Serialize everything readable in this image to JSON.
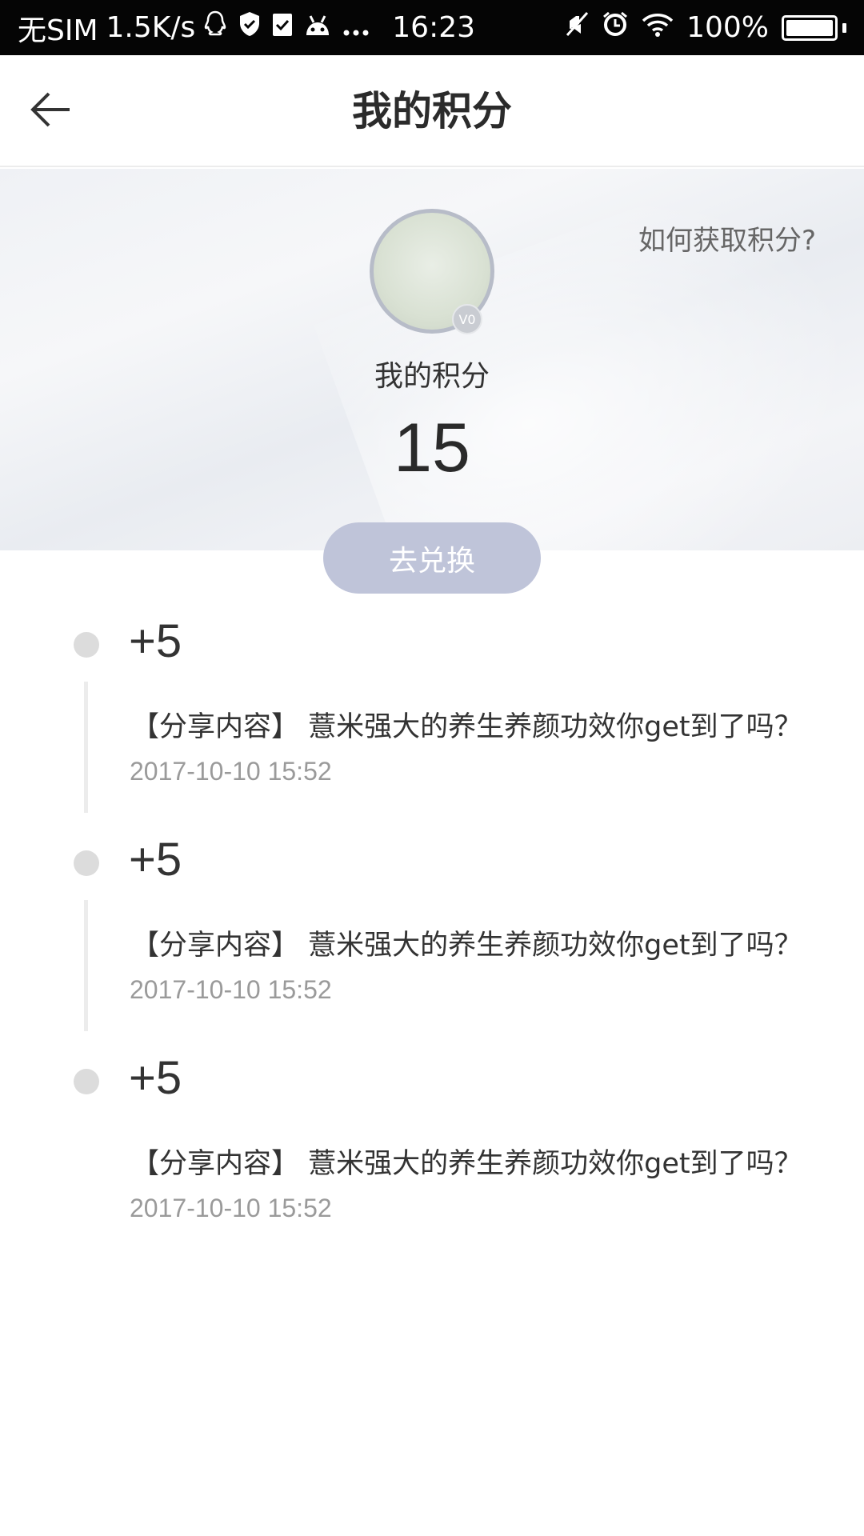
{
  "status_bar": {
    "carrier": "无SIM",
    "speed": "1.5K/s",
    "time": "16:23",
    "battery": "100%",
    "icons": [
      "qq-icon",
      "shield-icon",
      "clipboard-check-icon",
      "android-icon",
      "more-dots-icon",
      "mute-icon",
      "alarm-icon",
      "wifi-icon",
      "battery-icon"
    ]
  },
  "nav": {
    "title": "我的积分",
    "back_icon": "arrow-left-icon"
  },
  "header": {
    "how_to_link": "如何获取积分?",
    "level_badge": "V0",
    "points_label": "我的积分",
    "points_value": "15",
    "exchange_button": "去兑换"
  },
  "colors": {
    "exchange_button_bg": "#bfc4d9",
    "status_bar_bg": "#050505",
    "dot": "#dcdcdc",
    "timestamp": "#9a9a9a"
  },
  "records": [
    {
      "points": "+5",
      "description": "【分享内容】 薏米强大的养生养颜功效你get到了吗？",
      "time": "2017-10-10 15:52"
    },
    {
      "points": "+5",
      "description": "【分享内容】 薏米强大的养生养颜功效你get到了吗？",
      "time": "2017-10-10 15:52"
    },
    {
      "points": "+5",
      "description": "【分享内容】 薏米强大的养生养颜功效你get到了吗？",
      "time": "2017-10-10 15:52"
    }
  ]
}
